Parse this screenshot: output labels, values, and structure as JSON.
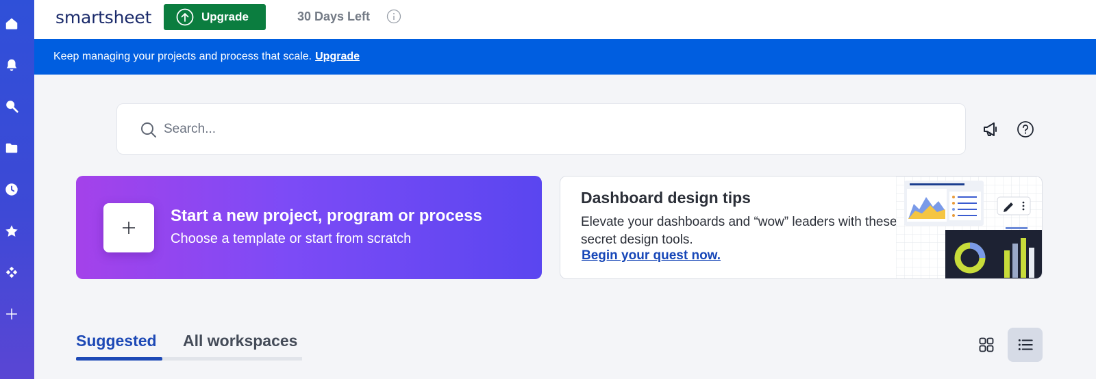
{
  "nav_rail": {
    "items": [
      {
        "icon": "home-icon"
      },
      {
        "icon": "bell-icon"
      },
      {
        "icon": "search-icon"
      },
      {
        "icon": "folder-icon"
      },
      {
        "icon": "clock-icon"
      },
      {
        "icon": "star-icon"
      },
      {
        "icon": "apps-icon"
      },
      {
        "icon": "plus-icon"
      }
    ]
  },
  "header": {
    "logo": "smartsheet",
    "upgrade_label": "Upgrade",
    "trial_text": "30 Days Left"
  },
  "banner": {
    "message": "Keep managing your projects and process that scale.",
    "link_label": "Upgrade"
  },
  "search": {
    "placeholder": "Search..."
  },
  "new_project_card": {
    "title": "Start a new project, program or process",
    "subtitle": "Choose a template or start from scratch"
  },
  "tips_card": {
    "title": "Dashboard design tips",
    "body": "Elevate your dashboards and “wow” leaders with these secret design tools.",
    "link_label": "Begin your quest now."
  },
  "tabs": [
    {
      "label": "Suggested",
      "active": true
    },
    {
      "label": "All workspaces",
      "active": false
    }
  ],
  "colors": {
    "brand_blue": "#005ee0",
    "upgrade_green": "#0b7d3f",
    "tab_active": "#1d49b6"
  }
}
